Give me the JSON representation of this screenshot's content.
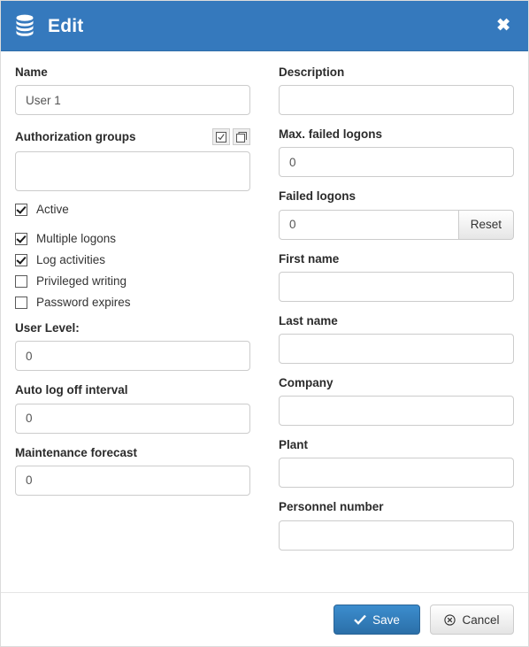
{
  "header": {
    "title": "Edit",
    "icon": "database-icon",
    "close_icon": "close-icon",
    "background_color": "#3579bd"
  },
  "left_column": {
    "name": {
      "label": "Name",
      "value": "User 1",
      "placeholder": ""
    },
    "authorization_groups": {
      "label": "Authorization groups",
      "value": "",
      "select_all_icon": "check-square-icon",
      "deselect-all_icon": "square-icon"
    },
    "checkboxes": [
      {
        "label": "Active",
        "checked": true
      },
      {
        "label": "Multiple logons",
        "checked": true
      },
      {
        "label": "Log activities",
        "checked": true
      },
      {
        "label": "Privileged writing",
        "checked": false
      },
      {
        "label": "Password expires",
        "checked": false
      }
    ],
    "user_level": {
      "label": "User Level:",
      "value": "0"
    },
    "auto_log_off_interval": {
      "label": "Auto log off interval",
      "value": "0"
    },
    "maintenance_forecast": {
      "label": "Maintenance forecast",
      "value": "0"
    }
  },
  "right_column": {
    "description": {
      "label": "Description",
      "value": ""
    },
    "max_failed_logons": {
      "label": "Max. failed logons",
      "value": "0"
    },
    "failed_logons": {
      "label": "Failed logons",
      "value": "0",
      "reset_label": "Reset"
    },
    "first_name": {
      "label": "First name",
      "value": ""
    },
    "last_name": {
      "label": "Last name",
      "value": ""
    },
    "company": {
      "label": "Company",
      "value": ""
    },
    "plant": {
      "label": "Plant",
      "value": ""
    },
    "personnel_number": {
      "label": "Personnel number",
      "value": ""
    }
  },
  "footer": {
    "save_label": "Save",
    "save_icon": "check-icon",
    "save_color": "#2b6fa8",
    "cancel_label": "Cancel",
    "cancel_icon": "cancel-circle-icon"
  }
}
